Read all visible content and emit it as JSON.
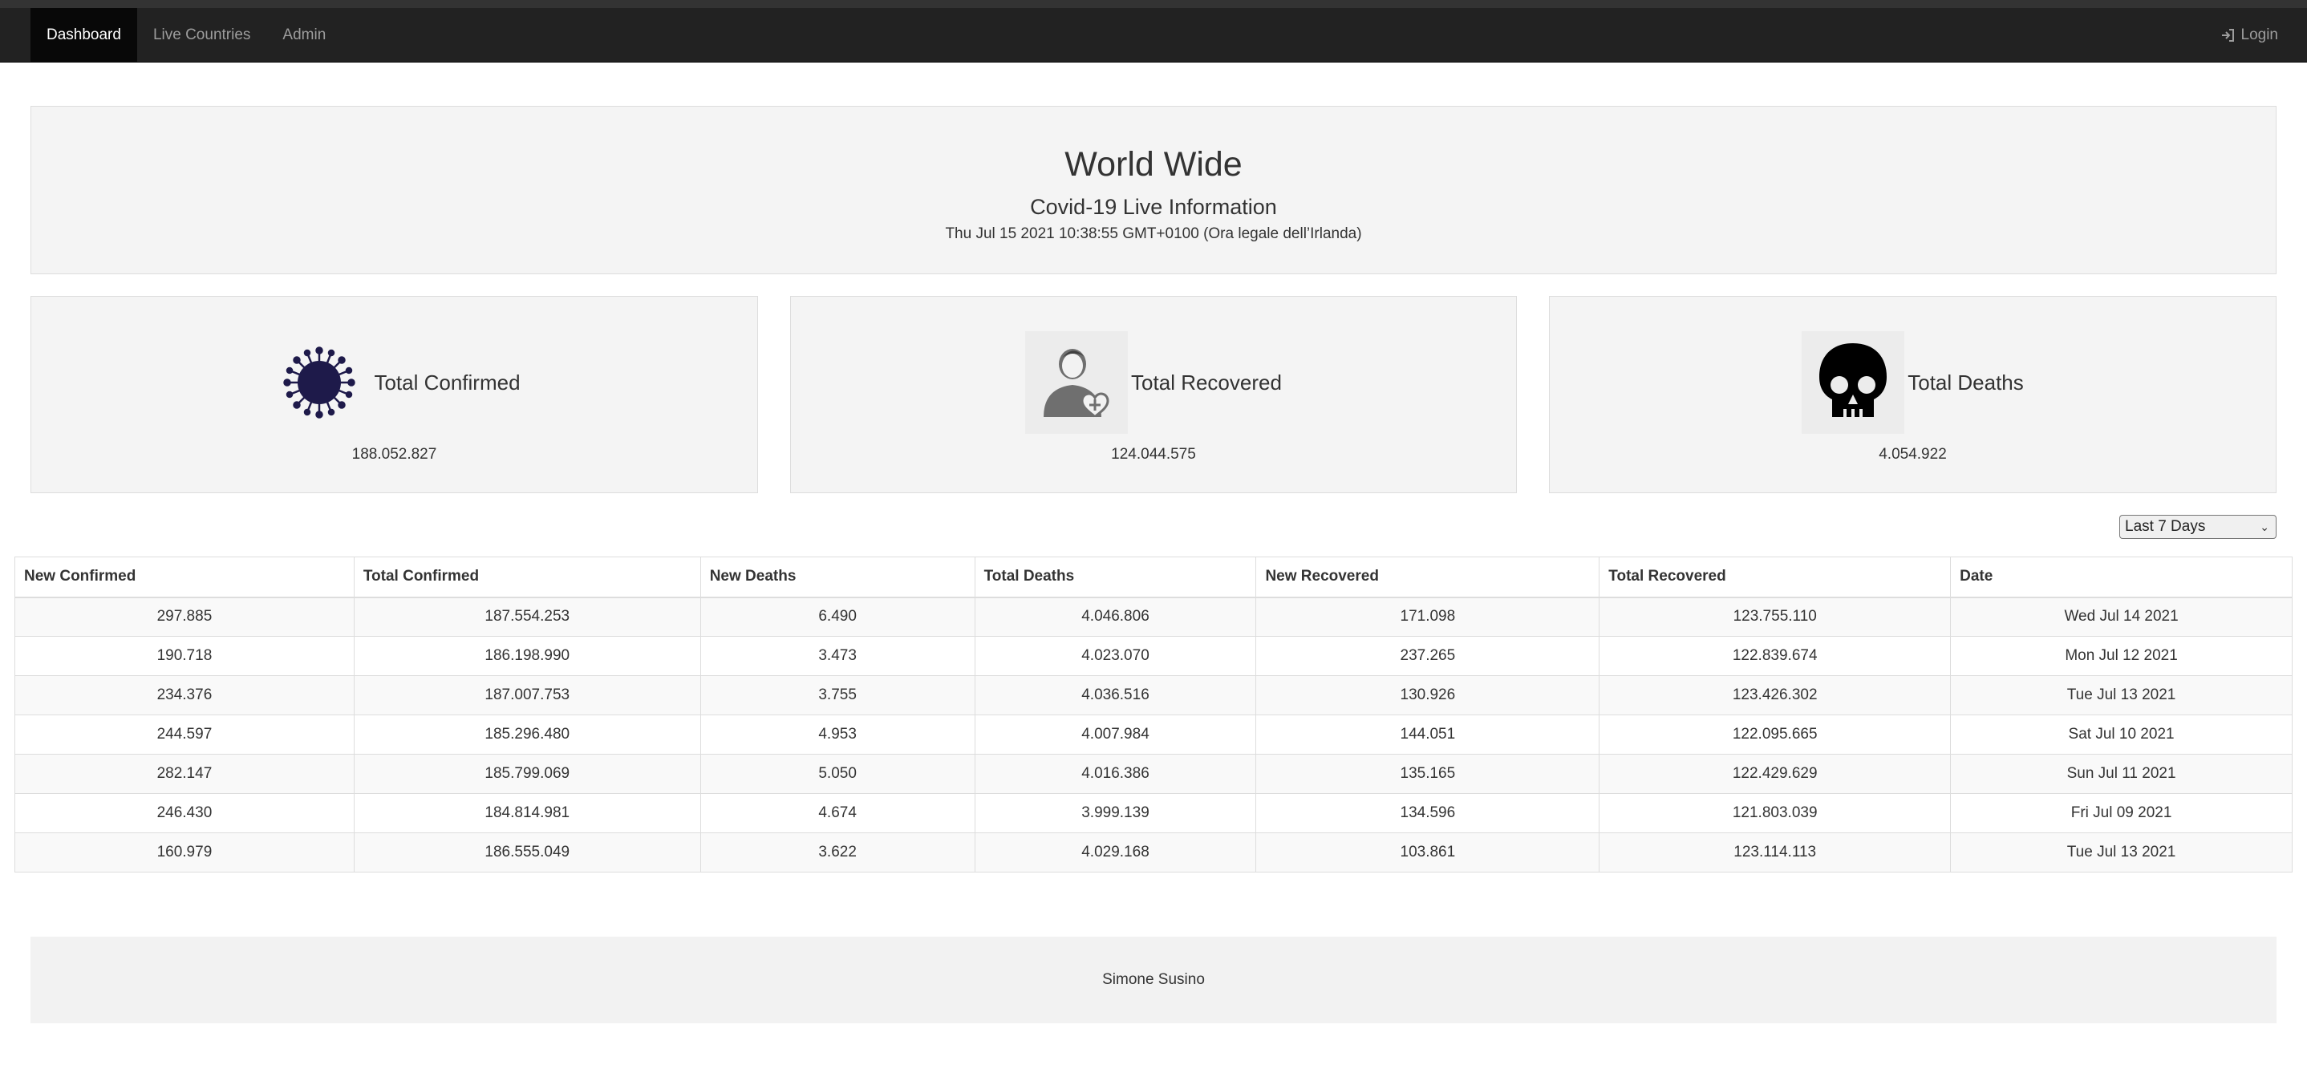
{
  "nav": {
    "items": [
      {
        "label": "Dashboard"
      },
      {
        "label": "Live Countries"
      },
      {
        "label": "Admin"
      }
    ],
    "login_label": "Login"
  },
  "header": {
    "title": "World Wide",
    "subtitle": "Covid-19 Live Information",
    "datetime": "Thu Jul 15 2021 10:38:55 GMT+0100 (Ora legale dell’Irlanda)"
  },
  "cards": [
    {
      "title": "Total Confirmed",
      "value": "188.052.827",
      "icon": "virus-icon"
    },
    {
      "title": "Total Recovered",
      "value": "124.044.575",
      "icon": "recovered-person-icon"
    },
    {
      "title": "Total Deaths",
      "value": "4.054.922",
      "icon": "skull-icon"
    }
  ],
  "range_select": {
    "selected": "Last 7 Days"
  },
  "table": {
    "headers": [
      "New Confirmed",
      "Total Confirmed",
      "New Deaths",
      "Total Deaths",
      "New Recovered",
      "Total Recovered",
      "Date"
    ],
    "rows": [
      [
        "297.885",
        "187.554.253",
        "6.490",
        "4.046.806",
        "171.098",
        "123.755.110",
        "Wed Jul 14 2021"
      ],
      [
        "190.718",
        "186.198.990",
        "3.473",
        "4.023.070",
        "237.265",
        "122.839.674",
        "Mon Jul 12 2021"
      ],
      [
        "234.376",
        "187.007.753",
        "3.755",
        "4.036.516",
        "130.926",
        "123.426.302",
        "Tue Jul 13 2021"
      ],
      [
        "244.597",
        "185.296.480",
        "4.953",
        "4.007.984",
        "144.051",
        "122.095.665",
        "Sat Jul 10 2021"
      ],
      [
        "282.147",
        "185.799.069",
        "5.050",
        "4.016.386",
        "135.165",
        "122.429.629",
        "Sun Jul 11 2021"
      ],
      [
        "246.430",
        "184.814.981",
        "4.674",
        "3.999.139",
        "134.596",
        "121.803.039",
        "Fri Jul 09 2021"
      ],
      [
        "160.979",
        "186.555.049",
        "3.622",
        "4.029.168",
        "103.861",
        "123.114.113",
        "Tue Jul 13 2021"
      ]
    ]
  },
  "footer": {
    "text": "Simone Susino"
  },
  "colors": {
    "navbar": "#222222",
    "virus": "#1e1a4a",
    "panel": "#f4f4f4"
  }
}
